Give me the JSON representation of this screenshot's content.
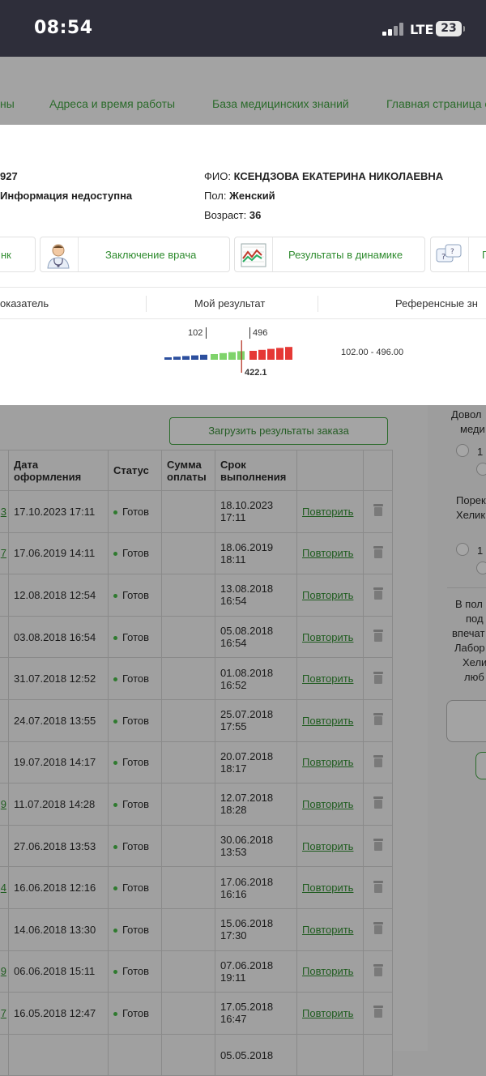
{
  "status_bar": {
    "time": "08:54",
    "network": "LTE",
    "battery": "23"
  },
  "nav": {
    "items": [
      "ны",
      "Адреса и время работы",
      "База медицинских знаний",
      "Главная страница с"
    ]
  },
  "patient": {
    "id_fragment": "927",
    "info_fragment": "Информация недоступна",
    "name_label": "ФИО:",
    "name": "КСЕНДЗОВА ЕКАТЕРИНА НИКОЛАЕВНА",
    "sex_label": "Пол:",
    "sex": "Женский",
    "age_label": "Возраст:",
    "age": "36"
  },
  "tabs": {
    "blank": "нк",
    "doctor": "Заключение врача",
    "dynamics": "Результаты в динамике",
    "more": "П"
  },
  "result_table": {
    "col_indicator": "оказатель",
    "col_result": "Мой результат",
    "col_reference": "Референсные зн",
    "low_mark": "102",
    "high_mark": "496",
    "value": "422.1",
    "reference": "102.00 - 496.00",
    "scale": {
      "min": 102,
      "max": 496,
      "value": 422.1
    }
  },
  "orders": {
    "load_button": "Загрузить результаты заказа",
    "headers": {
      "date": "Дата оформления",
      "status": "Статус",
      "sum": "Сумма оплаты",
      "due": "Срок выполнения"
    },
    "repeat_label": "Повторить",
    "rows": [
      {
        "mark": "3",
        "date": "17.10.2023 17:11",
        "status": "Готов",
        "due1": "18.10.2023",
        "due2": "17:11"
      },
      {
        "mark": "7",
        "date": "17.06.2019 14:11",
        "status": "Готов",
        "due1": "18.06.2019",
        "due2": "18:11"
      },
      {
        "mark": "",
        "date": "12.08.2018 12:54",
        "status": "Готов",
        "due1": "13.08.2018",
        "due2": "16:54"
      },
      {
        "mark": "",
        "date": "03.08.2018 16:54",
        "status": "Готов",
        "due1": "05.08.2018",
        "due2": "16:54"
      },
      {
        "mark": "",
        "date": "31.07.2018 12:52",
        "status": "Готов",
        "due1": "01.08.2018",
        "due2": "16:52"
      },
      {
        "mark": "",
        "date": "24.07.2018 13:55",
        "status": "Готов",
        "due1": "25.07.2018",
        "due2": "17:55"
      },
      {
        "mark": "",
        "date": "19.07.2018 14:17",
        "status": "Готов",
        "due1": "20.07.2018",
        "due2": "18:17"
      },
      {
        "mark": "9",
        "date": "11.07.2018 14:28",
        "status": "Готов",
        "due1": "12.07.2018",
        "due2": "18:28"
      },
      {
        "mark": "",
        "date": "27.06.2018 13:53",
        "status": "Готов",
        "due1": "30.06.2018",
        "due2": "13:53"
      },
      {
        "mark": "4",
        "date": "16.06.2018 12:16",
        "status": "Готов",
        "due1": "17.06.2018",
        "due2": "16:16"
      },
      {
        "mark": "",
        "date": "14.06.2018 13:30",
        "status": "Готов",
        "due1": "15.06.2018",
        "due2": "17:30"
      },
      {
        "mark": "9",
        "date": "06.06.2018 15:11",
        "status": "Готов",
        "due1": "07.06.2018",
        "due2": "19:11"
      },
      {
        "mark": "7",
        "date": "16.05.2018 12:47",
        "status": "Готов",
        "due1": "17.05.2018",
        "due2": "16:47"
      },
      {
        "mark": "",
        "date": "",
        "status": "",
        "due1": "05.05.2018",
        "due2": ""
      }
    ]
  },
  "sidebar": {
    "q1": [
      "Довол",
      "меди"
    ],
    "q2": [
      "Порек",
      "Хелик"
    ],
    "radio_label": "1",
    "text": [
      "В пол",
      "под",
      "впечат",
      "Лабор",
      "Хели",
      "люб"
    ]
  },
  "colors": {
    "low": "#2c4f9e",
    "normal": "#7fd36b",
    "high": "#e53935",
    "marker": "#b63a2a",
    "brand_green": "#2e8b2e"
  }
}
